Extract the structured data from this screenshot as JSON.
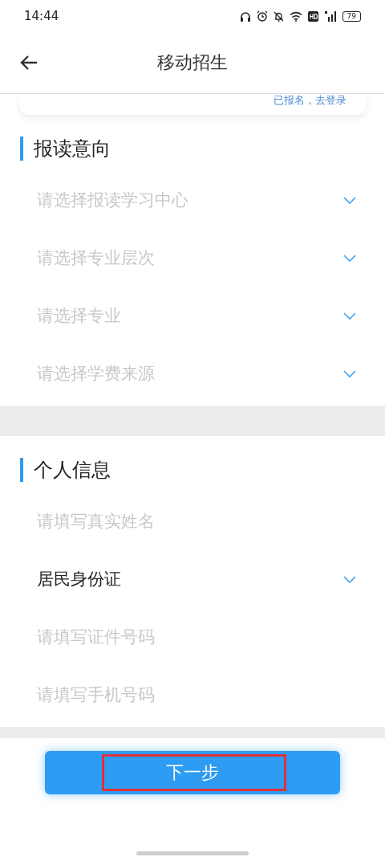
{
  "status_bar": {
    "time": "14:44",
    "battery": "79"
  },
  "header": {
    "title": "移动招生"
  },
  "login_card": {
    "link": "已报名，去登录"
  },
  "sections": [
    {
      "title": "报读意向",
      "fields": [
        {
          "kind": "select",
          "placeholder": "请选择报读学习中心"
        },
        {
          "kind": "select",
          "placeholder": "请选择专业层次"
        },
        {
          "kind": "select",
          "placeholder": "请选择专业"
        },
        {
          "kind": "select",
          "placeholder": "请选择学费来源"
        }
      ]
    },
    {
      "title": "个人信息",
      "fields": [
        {
          "kind": "input",
          "placeholder": "请填写真实姓名"
        },
        {
          "kind": "select",
          "value": "居民身份证"
        },
        {
          "kind": "input",
          "placeholder": "请填写证件号码"
        },
        {
          "kind": "input",
          "placeholder": "请填写手机号码"
        }
      ]
    }
  ],
  "next_button": {
    "label": "下一步",
    "highlighted": true
  }
}
